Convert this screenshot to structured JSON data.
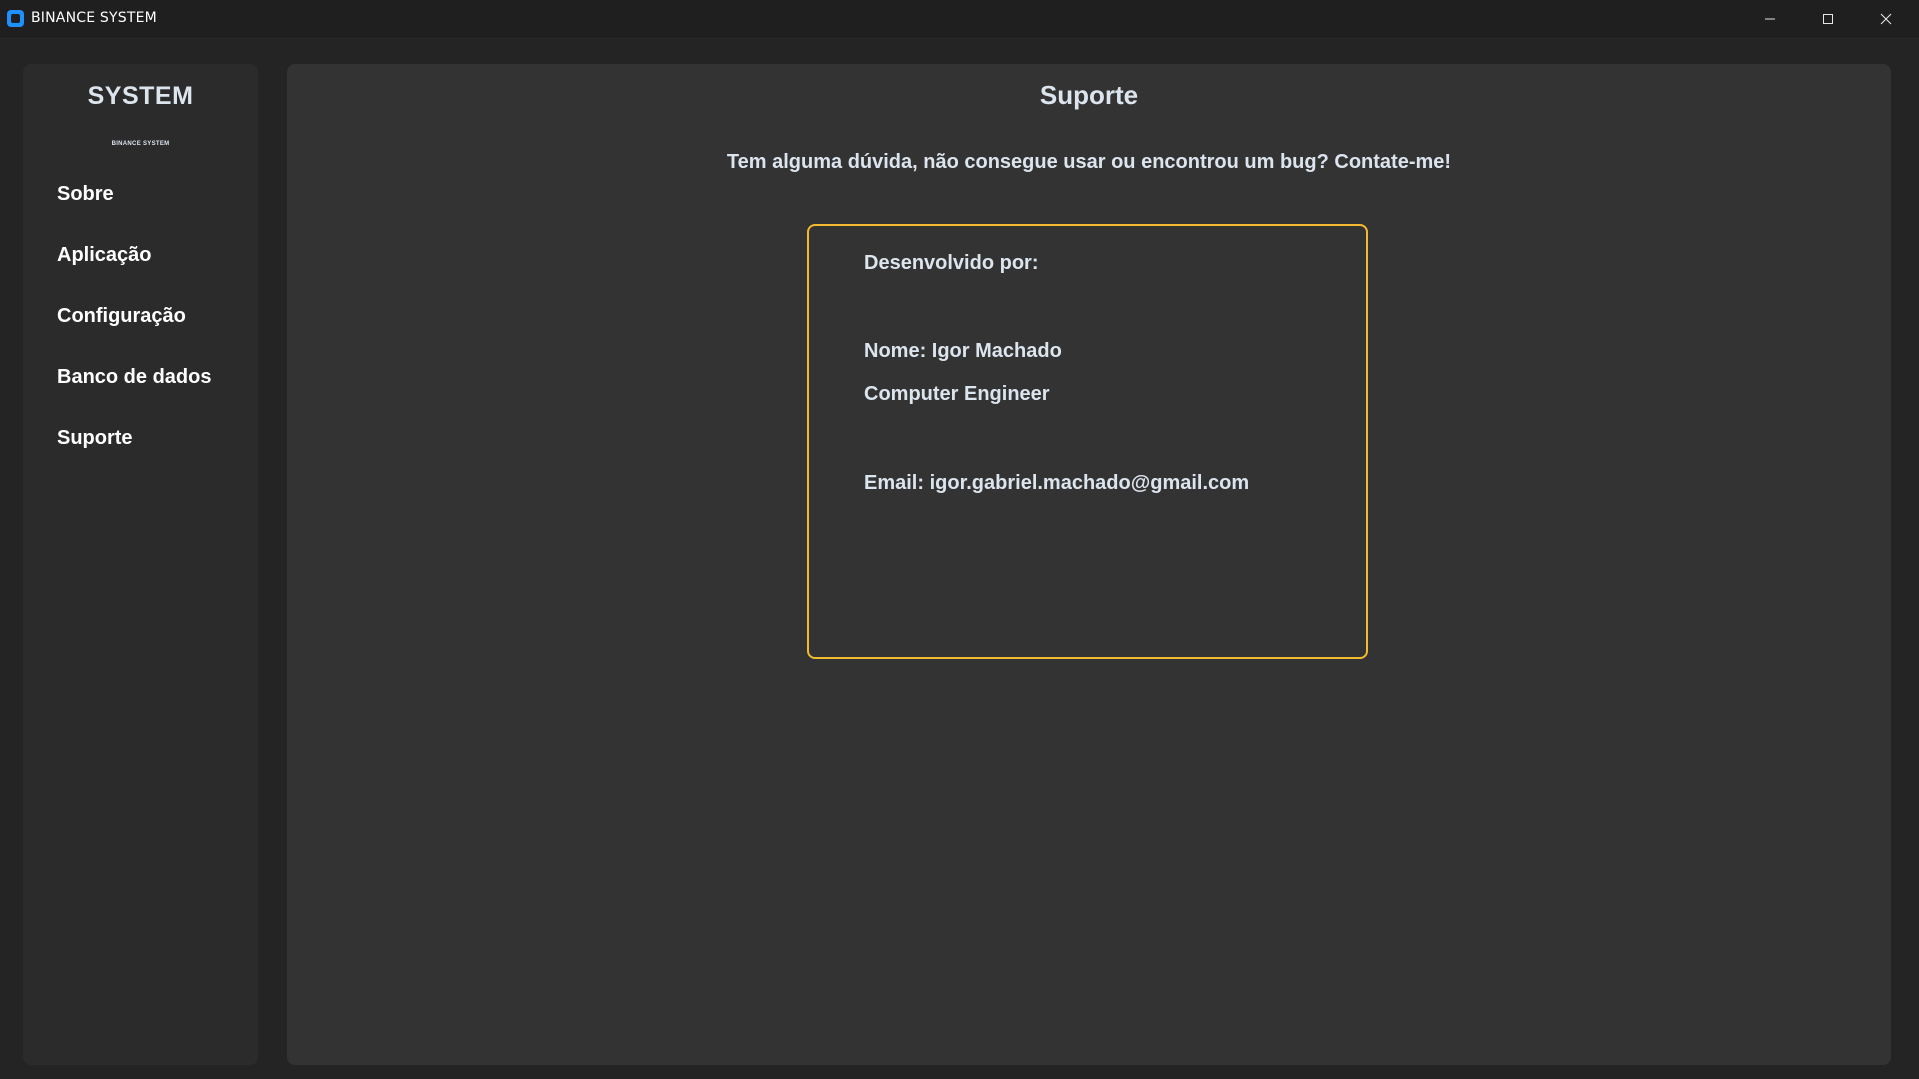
{
  "window": {
    "title": "BINANCE SYSTEM",
    "icon": "app-logo-icon",
    "controls": [
      "minimize-icon",
      "maximize-icon",
      "close-icon"
    ]
  },
  "sidebar": {
    "brand_title": "SYSTEM",
    "brand_subtitle": "BINANCE SYSTEM",
    "items": [
      {
        "label": "Sobre"
      },
      {
        "label": "Aplicação"
      },
      {
        "label": "Configuração"
      },
      {
        "label": "Banco de dados"
      },
      {
        "label": "Suporte"
      }
    ]
  },
  "main": {
    "title": "Suporte",
    "subtitle": "Tem alguma dúvida, não consegue usar ou encontrou um bug? Contate-me!",
    "card": {
      "developed_by": "Desenvolvido por:",
      "name": "Nome: Igor Machado",
      "role": "Computer Engineer",
      "email": "Email: igor.gabriel.machado@gmail.com"
    }
  },
  "colors": {
    "background": "#242424",
    "panel": "#333333",
    "sidebar": "#2b2b2b",
    "accent_border": "#f3ba2f",
    "text": "#dce4ee"
  }
}
